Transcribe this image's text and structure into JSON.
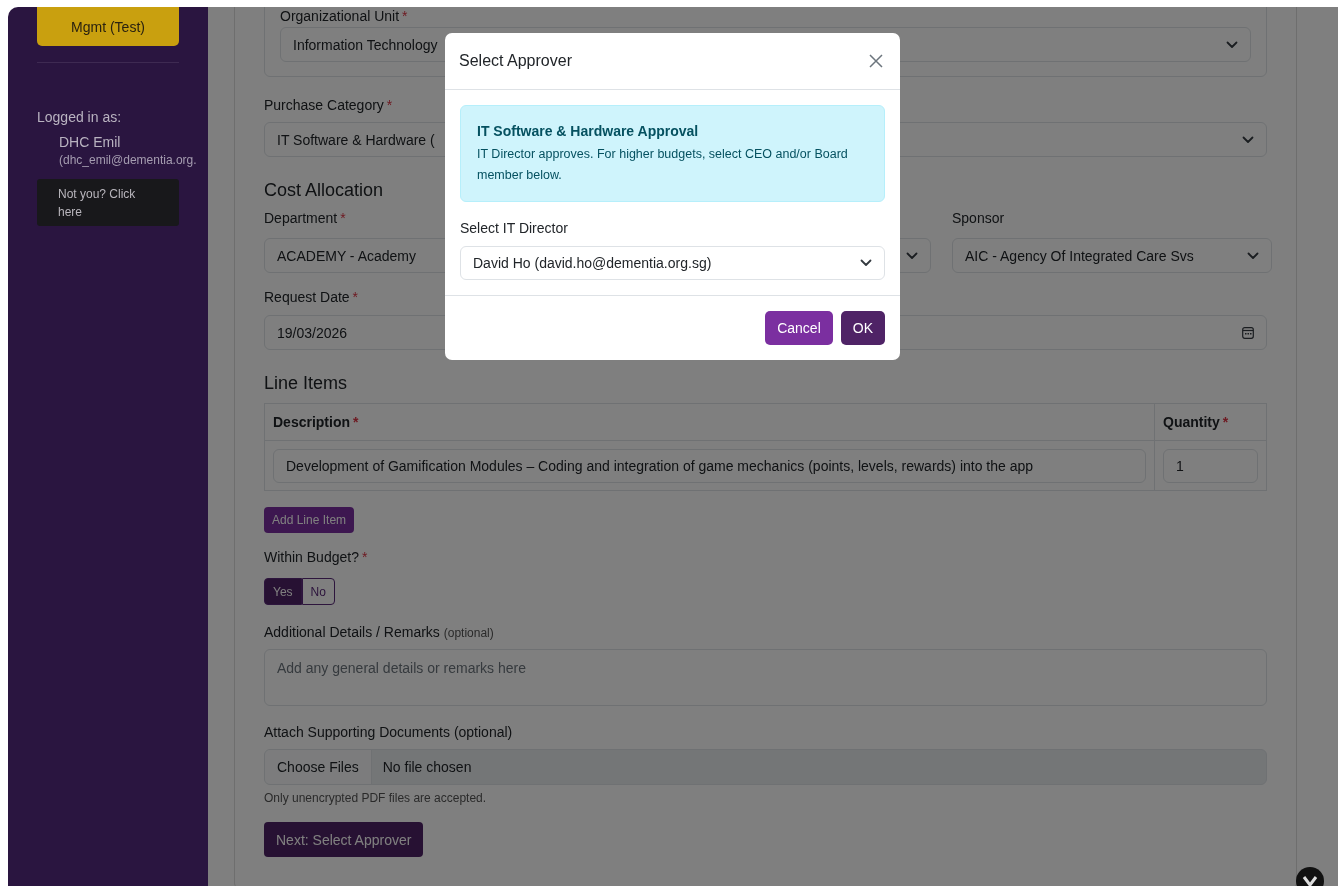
{
  "sidebar": {
    "vendor_button": "Mgmt (Test)",
    "logged_in_label": "Logged in as:",
    "user_name": "DHC Emil",
    "user_email": "(dhc_emil@dementia.org.",
    "not_you_button": "Not you? Click here"
  },
  "form": {
    "org_unit": {
      "label": "Organizational Unit",
      "mark": "*",
      "value": "Information Technology"
    },
    "purchase_category": {
      "label": "Purchase Category",
      "mark": "*",
      "value": "IT Software & Hardware ("
    },
    "cost_allocation": {
      "heading": "Cost Allocation",
      "fields": [
        {
          "kind": "select",
          "label": "Department",
          "mark": "*",
          "value": "ACADEMY - Academy"
        },
        {
          "kind": "select"
        },
        {
          "kind": "select",
          "label": "Sponsor",
          "value": "AIC - Agency Of Integrated Care Svs"
        }
      ]
    },
    "request_date": {
      "label": "Request Date",
      "mark": "*",
      "value": "19/03/2026"
    },
    "line_items": {
      "heading": "Line Items",
      "columns": [
        {
          "label": "Description",
          "mark": "*"
        },
        {
          "label": "Quantity",
          "mark": "*"
        }
      ],
      "rows": [
        [
          "Development of Gamification Modules – Coding and integration of game mechanics (points, levels, rewards) into the app",
          "1"
        ]
      ],
      "add_button": "Add Line Item"
    },
    "within_budget": {
      "label": "Within Budget?",
      "mark": "*",
      "options": [
        {
          "label": "Yes",
          "selected": true
        },
        {
          "label": "No",
          "selected": false
        }
      ]
    },
    "remarks": {
      "label": "Additional Details / Remarks",
      "hint": "(optional)",
      "placeholder": "Add any general details or remarks here"
    },
    "attachments": {
      "label": "Attach Supporting Documents (optional)",
      "button": "Choose Files",
      "status": "No file chosen",
      "help": "Only unencrypted PDF files are accepted."
    },
    "next_button": "Next: Select Approver"
  },
  "modal": {
    "title": "Select Approver",
    "alert": {
      "title": "IT Software & Hardware Approval",
      "text": "IT Director approves. For higher budgets, select CEO and/or Board member below."
    },
    "select_label": "Select IT Director",
    "select_value": "David Ho (david.ho@dementia.org.sg)",
    "buttons": [
      {
        "label": "Cancel",
        "kind": "secondary"
      },
      {
        "label": "OK",
        "kind": "primary"
      }
    ]
  }
}
